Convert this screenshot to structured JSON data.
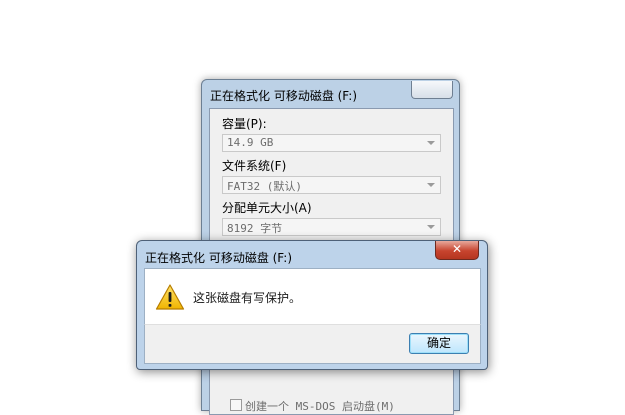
{
  "format_window": {
    "title": "正在格式化 可移动磁盘 (F:)",
    "capacity": {
      "label": "容量(P):",
      "value": "14.9 GB"
    },
    "filesystem": {
      "label": "文件系统(F)",
      "value": "FAT32 (默认)"
    },
    "allocation": {
      "label": "分配单元大小(A)",
      "value": "8192 字节"
    },
    "msdos_checkbox": {
      "label": "创建一个 MS-DOS 启动盘(M)",
      "checked": false
    }
  },
  "alert_dialog": {
    "title": "正在格式化 可移动磁盘 (F:)",
    "icon": "warning-icon",
    "message": "这张磁盘有写保护。",
    "close_glyph": "✕",
    "ok_label": "确定"
  }
}
